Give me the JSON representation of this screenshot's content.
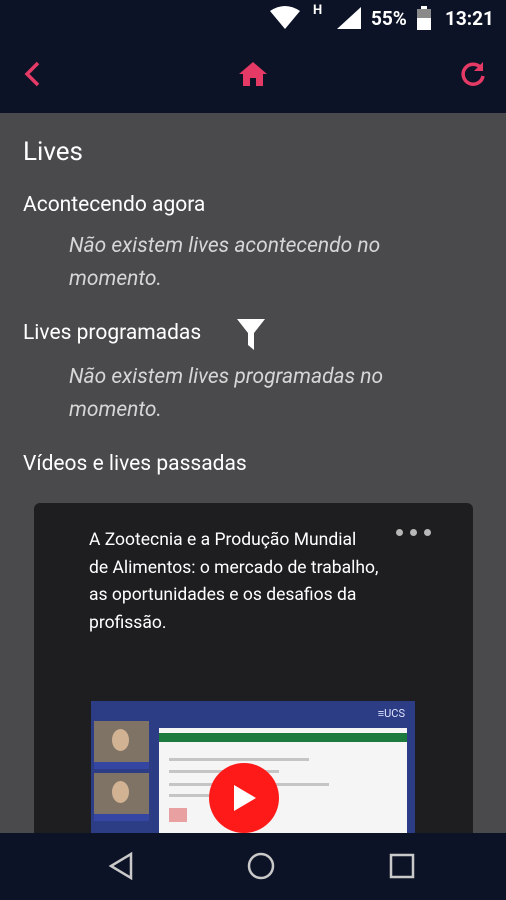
{
  "status": {
    "battery": "55%",
    "time": "13:21",
    "network": "H"
  },
  "appbar": {
    "back_icon": "chevron-left-icon",
    "home_icon": "home-icon",
    "refresh_icon": "refresh-icon",
    "accent": "#e63a66"
  },
  "page": {
    "title": "Lives",
    "now_heading": "Acontecendo agora",
    "now_empty_line1": "Não existem lives acontecendo no",
    "now_empty_line2": "momento.",
    "scheduled_heading": "Lives programadas",
    "scheduled_empty_line1": "Não existem lives programadas no",
    "scheduled_empty_line2": "momento.",
    "past_heading": "Vídeos e lives passadas"
  },
  "video": {
    "title": "A Zootecnia e a Produção Mundial de Alimentos: o mercado de trabalho, as oportunidades e os desafios da profissão.",
    "thumbnail_brand": "≡UCS"
  },
  "navbar": {
    "back": "triangle-back-icon",
    "home": "circle-home-icon",
    "recents": "square-recents-icon"
  }
}
